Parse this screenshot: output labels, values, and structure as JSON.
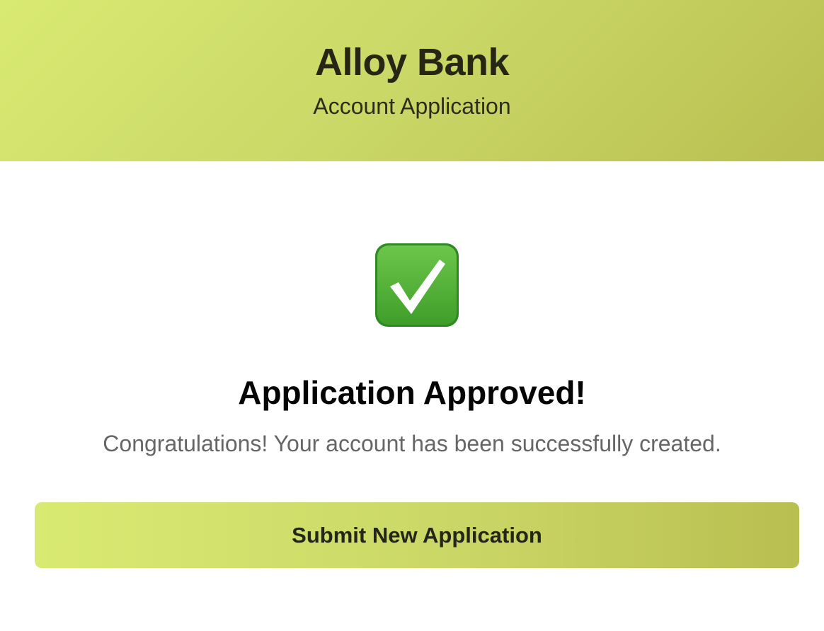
{
  "header": {
    "title": "Alloy Bank",
    "subtitle": "Account Application"
  },
  "result": {
    "icon": "check-mark-icon",
    "title": "Application Approved!",
    "message": "Congratulations! Your account has been successfully created."
  },
  "actions": {
    "submit_new_label": "Submit New Application"
  },
  "colors": {
    "accent_start": "#d9ea72",
    "accent_end": "#b9bf50",
    "success_green": "#4caf32"
  }
}
